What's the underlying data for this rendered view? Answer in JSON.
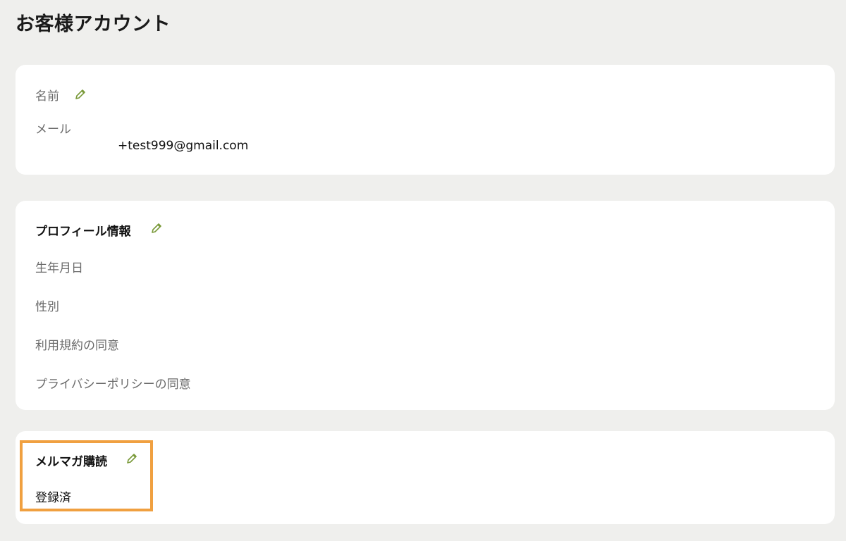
{
  "page": {
    "title": "お客様アカウント"
  },
  "account": {
    "name_label": "名前",
    "email_label": "メール",
    "email_value": "+test999@gmail.com"
  },
  "profile": {
    "heading": "プロフィール情報",
    "birthday_label": "生年月日",
    "gender_label": "性別",
    "terms_label": "利用規約の同意",
    "privacy_label": "プライバシーポリシーの同意"
  },
  "newsletter": {
    "heading": "メルマガ購読",
    "status": "登録済"
  },
  "colors": {
    "background": "#efefed",
    "card": "#ffffff",
    "edit_icon": "#7a9a3a",
    "highlight": "#f0a040"
  },
  "icons": {
    "edit": "pencil-icon"
  }
}
